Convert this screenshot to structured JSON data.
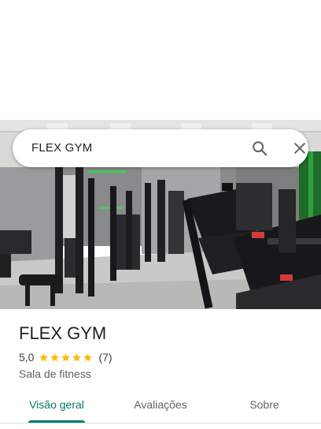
{
  "search": {
    "value": "FLEX GYM",
    "search_icon": "search-icon",
    "close_icon": "close-icon"
  },
  "place": {
    "title": "FLEX GYM",
    "rating": "5,0",
    "stars": 5,
    "reviews": "(7)",
    "category": "Sala de fitness"
  },
  "tabs": [
    {
      "label": "Visão geral",
      "active": true
    },
    {
      "label": "Avaliações",
      "active": false
    },
    {
      "label": "Sobre",
      "active": false
    }
  ],
  "colors": {
    "accent": "#00796b",
    "star": "#fbbc04",
    "text_primary": "#202124",
    "text_secondary": "#5f6368"
  }
}
